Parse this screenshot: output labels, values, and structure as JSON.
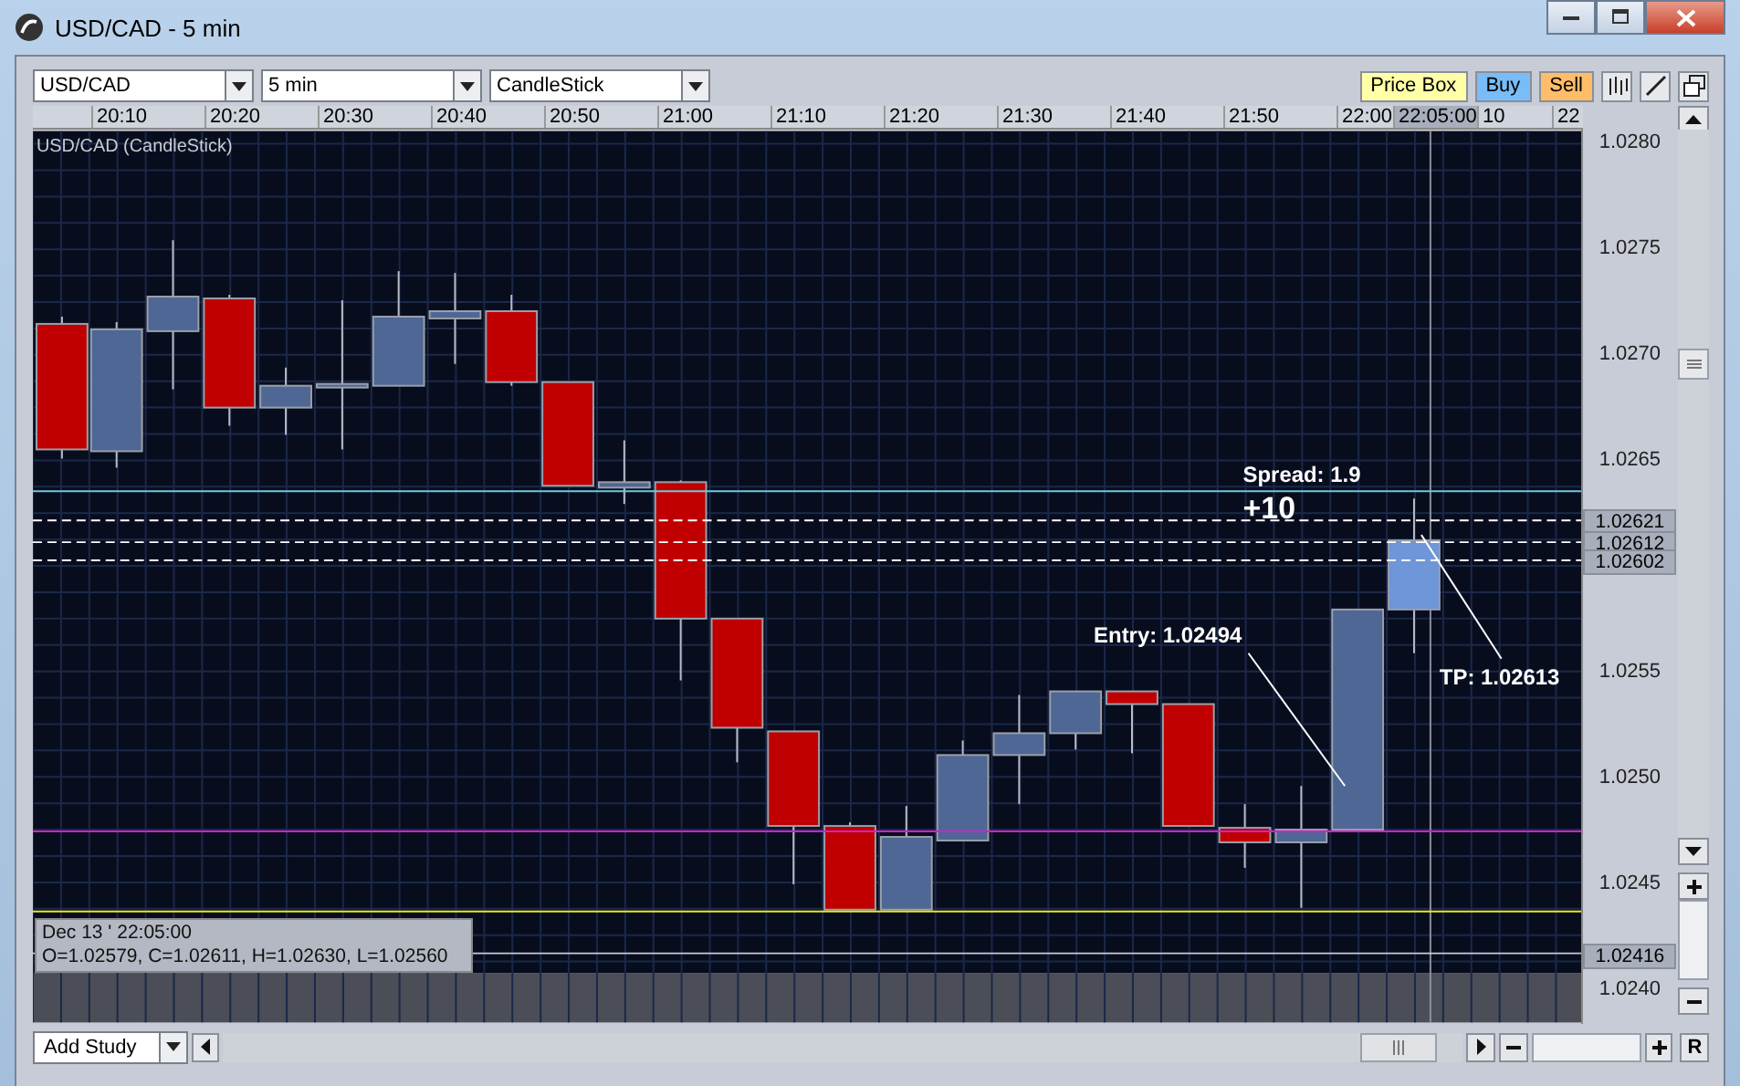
{
  "window": {
    "title": "USD/CAD - 5 min"
  },
  "toolbar": {
    "symbol": "USD/CAD",
    "interval": "5 min",
    "chart_type": "CandleStick",
    "buttons": [
      {
        "label": "Price Box",
        "kind": "pricebox"
      },
      {
        "label": "Buy",
        "kind": "buy"
      },
      {
        "label": "Sell",
        "kind": "sell"
      }
    ]
  },
  "time_axis": {
    "labels": [
      "20:10",
      "20:20",
      "20:30",
      "20:40",
      "20:50",
      "21:00",
      "21:10",
      "21:20",
      "21:30",
      "21:40",
      "21:50",
      "22:00"
    ],
    "cursor_label": "22:05:00",
    "after_labels": [
      "10",
      "22"
    ]
  },
  "chart": {
    "title": "USD/CAD (CandleStick)",
    "annotations": [
      {
        "text": "Spread: 1.9",
        "kind": "note"
      },
      {
        "text": "+10",
        "kind": "big"
      },
      {
        "text": "Entry: 1.02494",
        "kind": "leader"
      },
      {
        "text": "TP: 1.02613",
        "kind": "leader"
      }
    ],
    "info": {
      "date": "Dec 13 ' 22:05:00",
      "ohlc": "O=1.02579, C=1.02611, H=1.02630, L=1.02560"
    }
  },
  "price_axis": {
    "ticks": [
      "1.0280",
      "1.0275",
      "1.0270",
      "1.0265",
      "1.0255",
      "1.0250",
      "1.0245",
      "1.0240"
    ],
    "markers": [
      "1.02621",
      "1.02612",
      "1.02602",
      "1.02416"
    ]
  },
  "bottom": {
    "study_button": "Add Study",
    "reset_button": "R"
  }
}
